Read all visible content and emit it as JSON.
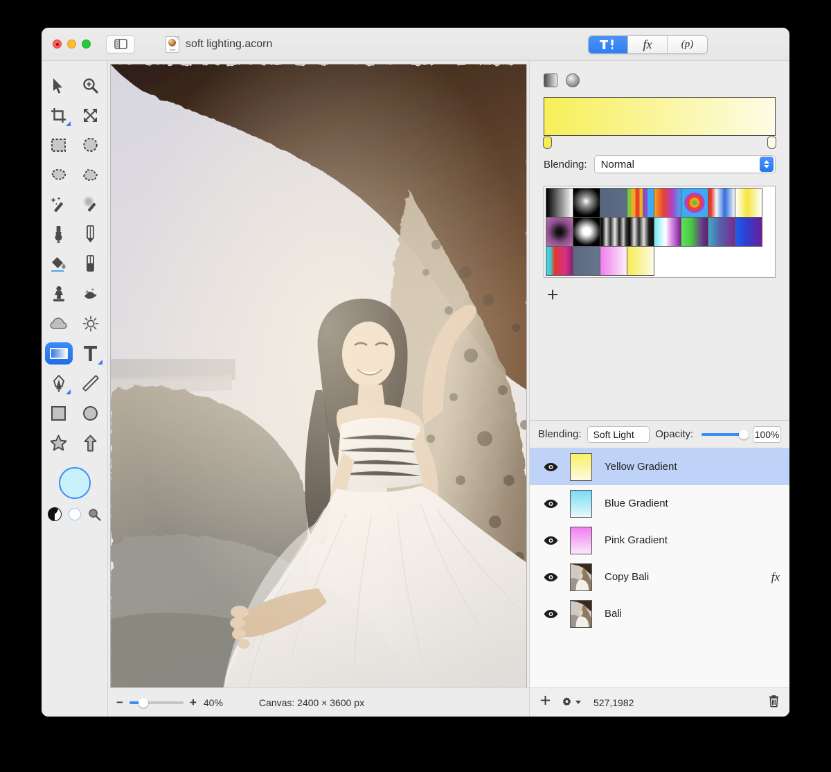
{
  "window": {
    "title": "soft lighting.acorn",
    "traffic_lights": [
      "close",
      "minimize",
      "zoom"
    ],
    "sidebar_toggle_icon": "sidebar-toggle-icon",
    "document_icon": "acorn-document-icon",
    "document_icon_label": "Acorn"
  },
  "inspector_segments": [
    {
      "id": "tools",
      "icon": "hammer-and-pen-icon",
      "label": "",
      "active": true
    },
    {
      "id": "filters",
      "icon": "fx-icon",
      "label": "fx",
      "active": false
    },
    {
      "id": "presets",
      "icon": "p-icon",
      "label": "(p)",
      "active": false
    }
  ],
  "tools": [
    {
      "name": "move-tool",
      "icon": "arrow-cursor-icon",
      "selected": false,
      "has_submenu": false
    },
    {
      "name": "zoom-tool",
      "icon": "magnifier-plus-icon",
      "selected": false,
      "has_submenu": false
    },
    {
      "name": "crop-tool",
      "icon": "crop-icon",
      "selected": false,
      "has_submenu": true
    },
    {
      "name": "transform-tool",
      "icon": "move-arrows-icon",
      "selected": false,
      "has_submenu": false
    },
    {
      "name": "rectangle-select-tool",
      "icon": "rect-marquee-icon",
      "selected": false,
      "has_submenu": false
    },
    {
      "name": "ellipse-select-tool",
      "icon": "ellipse-marquee-icon",
      "selected": false,
      "has_submenu": false
    },
    {
      "name": "lasso-tool",
      "icon": "lasso-icon",
      "selected": false,
      "has_submenu": false
    },
    {
      "name": "polygon-lasso-tool",
      "icon": "polygon-lasso-icon",
      "selected": false,
      "has_submenu": false
    },
    {
      "name": "magic-wand-tool",
      "icon": "magic-wand-icon",
      "selected": false,
      "has_submenu": false
    },
    {
      "name": "soft-magic-wand-tool",
      "icon": "soft-magic-wand-icon",
      "selected": false,
      "has_submenu": false
    },
    {
      "name": "brush-tool",
      "icon": "paintbrush-icon",
      "selected": false,
      "has_submenu": false
    },
    {
      "name": "pencil-tool",
      "icon": "pencil-icon",
      "selected": false,
      "has_submenu": false
    },
    {
      "name": "paint-bucket-tool",
      "icon": "paint-bucket-icon",
      "selected": false,
      "has_submenu": false
    },
    {
      "name": "eraser-tool",
      "icon": "eraser-icon",
      "selected": false,
      "has_submenu": false
    },
    {
      "name": "clone-stamp-tool",
      "icon": "clone-stamp-icon",
      "selected": false,
      "has_submenu": false
    },
    {
      "name": "smudge-tool",
      "icon": "smudge-icon",
      "selected": false,
      "has_submenu": false
    },
    {
      "name": "blur-tool",
      "icon": "cloud-blur-icon",
      "selected": false,
      "has_submenu": false
    },
    {
      "name": "dodge-tool",
      "icon": "sun-dodge-icon",
      "selected": false,
      "has_submenu": false
    },
    {
      "name": "gradient-tool",
      "icon": "gradient-icon",
      "selected": true,
      "has_submenu": false
    },
    {
      "name": "text-tool",
      "icon": "text-t-icon",
      "selected": false,
      "has_submenu": true
    },
    {
      "name": "pen-tool",
      "icon": "bezier-pen-icon",
      "selected": false,
      "has_submenu": true
    },
    {
      "name": "line-tool",
      "icon": "line-icon",
      "selected": false,
      "has_submenu": false
    },
    {
      "name": "rectangle-shape-tool",
      "icon": "square-shape-icon",
      "selected": false,
      "has_submenu": false
    },
    {
      "name": "ellipse-shape-tool",
      "icon": "circle-shape-icon",
      "selected": false,
      "has_submenu": false
    },
    {
      "name": "star-shape-tool",
      "icon": "star-shape-icon",
      "selected": false,
      "has_submenu": false
    },
    {
      "name": "arrow-shape-tool",
      "icon": "arrow-shape-icon",
      "selected": false,
      "has_submenu": false
    }
  ],
  "color_well": {
    "foreground_color": "#c9f1fb",
    "contrast_icon": "contrast-circle-icon",
    "background_icon": "white-circle-icon",
    "magnifier_icon": "magnifier-icon"
  },
  "gradient_panel": {
    "type_buttons": [
      {
        "name": "linear-gradient-button",
        "icon": "linear-gradient-icon",
        "active": true
      },
      {
        "name": "radial-gradient-button",
        "icon": "radial-gradient-icon",
        "active": false
      }
    ],
    "preview_start_color": "#f6ef57",
    "preview_end_color": "#fdfce6",
    "stops": [
      {
        "position": 0,
        "color": "#f5ec52"
      },
      {
        "position": 100,
        "color": "#fcfbe9"
      }
    ],
    "blending_label": "Blending:",
    "blending_value": "Normal",
    "add_button_icon": "plus-icon",
    "swatches": [
      {
        "name": "black-to-white",
        "css": "linear-gradient(90deg,#000,#fff)"
      },
      {
        "name": "radial-white-glow",
        "css": "radial-gradient(circle at 48% 45%, #fff 0%, #9a9a9a 22%, #000 70%)"
      },
      {
        "name": "slate-blue",
        "css": "linear-gradient(90deg,#56657f,#5d6d86)"
      },
      {
        "name": "rainbow-stripes",
        "css": "linear-gradient(90deg,#7ac943 0 14%,#f5a623 14% 30%,#e8432f 30% 46%,#f0b21a 46% 58%,#8a4fbf 58% 76%,#3fa9f5 76% 100%)"
      },
      {
        "name": "rainbow-smooth",
        "css": "linear-gradient(90deg,#f5a623,#e8432f,#b43fbf,#3fa9f5)"
      },
      {
        "name": "concentric-rings",
        "css": "radial-gradient(circle at 50% 50%, #5bbd52 0 12%, #f0a11a 12% 26%, #e8432f 26% 40%, #b43fbf 40% 52%, #3fa9f5 52% 100%)"
      },
      {
        "name": "red-white-blue",
        "css": "linear-gradient(90deg,#e03a2a 0 10%,#f7f7f7 30%,#2f6fe0 62%,#f7f7f7 100%)"
      },
      {
        "name": "transparent-yellow",
        "css": "linear-gradient(90deg,rgba(245,230,60,0) 0%, #f5e63c 45%, rgba(245,230,60,0) 100%)"
      },
      {
        "name": "purple-black-radial",
        "css": "radial-gradient(circle at 50% 50%, #111 0 14%, #8a4f8a 55%, #c070b0 100%)"
      },
      {
        "name": "white-blob-radial",
        "css": "radial-gradient(circle at 50% 48%, #fff 0 18%, #c6c6c6 32%, #000 72%)"
      },
      {
        "name": "grey-stripes-a",
        "css": "linear-gradient(90deg,#111 0 8%,#ddd 22%,#333 38%,#e8e8e8 55%,#222 72%,#cfcfcf 88%,#111 100%)"
      },
      {
        "name": "grey-stripes-b",
        "css": "linear-gradient(90deg,#111 0 10%,#e2e2e2 26%,#2a2a2a 44%,#e0e0e0 62%,#1d1d1d 82%,#111 100%)"
      },
      {
        "name": "cyan-white-purple",
        "css": "linear-gradient(90deg,#6fe8f5 0%,#ffffff 42%,#d78ae8 66%,#7b1f8f 100%)"
      },
      {
        "name": "green-to-purple",
        "css": "linear-gradient(90deg,#5fe05f 0%,#46c93e 38%,#6b3a8a 78%,#5a1f6f 100%)"
      },
      {
        "name": "teal-to-purple",
        "css": "linear-gradient(90deg,#3fa9c9 0%,#5560a8 45%,#7b2a8f 100%)"
      },
      {
        "name": "blue-to-purple",
        "css": "linear-gradient(90deg,#1b5fe8 0%,#2f3fd0 40%,#6a1f9a 100%)"
      },
      {
        "name": "cyan-red",
        "css": "linear-gradient(90deg,#3fd0d8 0 14%,#e03a2a 32%,#d92f8a 72%,#8a1f6f 100%)"
      },
      {
        "name": "slate-gray",
        "css": "linear-gradient(90deg,#5b6a82,#66768d)"
      },
      {
        "name": "pink-to-white",
        "css": "linear-gradient(90deg,#f07ef0 0%,#f3a8f3 40%,#fdf0fd 100%)"
      },
      {
        "name": "yellow-to-white",
        "css": "linear-gradient(90deg,#f6ee56 0%,#faf4a0 55%,#fdfce8 100%)"
      }
    ]
  },
  "layers_panel": {
    "blending_label": "Blending:",
    "blending_value": "Soft Light",
    "opacity_label": "Opacity:",
    "opacity_value": "100%",
    "opacity_percent": 100,
    "layers": [
      {
        "name": "Yellow Gradient",
        "visible": true,
        "selected": true,
        "has_fx": false,
        "thumb_type": "gradient",
        "thumb_css": "linear-gradient(180deg,#f7f066,#fdfbe4)"
      },
      {
        "name": "Blue Gradient",
        "visible": true,
        "selected": false,
        "has_fx": false,
        "thumb_type": "gradient",
        "thumb_css": "linear-gradient(180deg,#79dcf2,#e6f9fd)"
      },
      {
        "name": "Pink Gradient",
        "visible": true,
        "selected": false,
        "has_fx": false,
        "thumb_type": "gradient",
        "thumb_css": "linear-gradient(180deg,#f07ef0,#fbe8fb)"
      },
      {
        "name": "Copy Bali",
        "visible": true,
        "selected": false,
        "has_fx": true,
        "thumb_type": "photo",
        "thumb_css": ""
      },
      {
        "name": "Bali",
        "visible": true,
        "selected": false,
        "has_fx": false,
        "thumb_type": "photo",
        "thumb_css": ""
      }
    ],
    "fx_badge_label": "fx",
    "toolbar": {
      "add_icon": "plus-icon",
      "settings_icon": "gear-icon",
      "coordinates": "527,1982",
      "delete_icon": "trash-icon"
    }
  },
  "statusbar": {
    "zoom_out_label": "−",
    "zoom_in_label": "+",
    "zoom_value": "40%",
    "zoom_percent": 40,
    "canvas_size": "Canvas: 2400 × 3600 px"
  },
  "canvas": {
    "description": "Photograph of a woman in a white tulle dress seated barefoot on a rock beneath a cave overhang, ocean and pale sky behind"
  }
}
